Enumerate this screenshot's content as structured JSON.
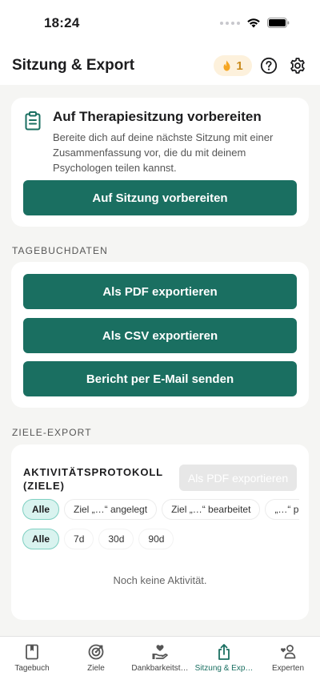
{
  "status_bar": {
    "time": "18:24"
  },
  "header": {
    "title": "Sitzung & Export",
    "streak_count": "1"
  },
  "session_card": {
    "title": "Auf Therapiesitzung vorbereiten",
    "description": "Bereite dich auf deine nächste Sitzung mit einer Zusammenfassung vor, die du mit deinem Psychologen teilen kannst.",
    "button": "Auf Sitzung vorbereiten"
  },
  "diary_section": {
    "label": "TAGEBUCHDATEN",
    "pdf_button": "Als PDF exportieren",
    "csv_button": "Als CSV exportieren",
    "email_button": "Bericht per E-Mail senden"
  },
  "goals_section": {
    "label": "ZIELE-EXPORT",
    "activity_title": "AKTIVITÄTSPROTOKOLL (ZIELE)",
    "pdf_button": "Als PDF exportieren",
    "type_filters": [
      "Alle",
      "Ziel „…“ angelegt",
      "Ziel „…“ bearbeitet",
      "„…“ pausiert"
    ],
    "range_filters": [
      "Alle",
      "7d",
      "30d",
      "90d"
    ],
    "empty_text": "Noch keine Aktivität."
  },
  "tabs": [
    {
      "label": "Tagebuch",
      "icon": "book-icon",
      "active": false
    },
    {
      "label": "Ziele",
      "icon": "target-icon",
      "active": false
    },
    {
      "label": "Dankbarkeitst…",
      "icon": "heart-hand-icon",
      "active": false
    },
    {
      "label": "Sitzung & Exp…",
      "icon": "share-icon",
      "active": true
    },
    {
      "label": "Experten",
      "icon": "experts-icon",
      "active": false
    }
  ],
  "colors": {
    "accent": "#1a6f61",
    "streak_bg": "#fdf1dc",
    "chip_active_bg": "#d9f3ef"
  }
}
